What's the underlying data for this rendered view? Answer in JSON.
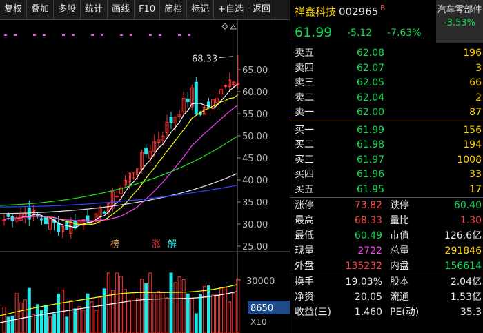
{
  "toolbar": [
    "复权",
    "叠加",
    "多股",
    "统计",
    "画线",
    "F10",
    "简档",
    "标记",
    "+自选",
    "返回"
  ],
  "stock": {
    "name": "祥鑫科技",
    "code": "002965",
    "badge": "R",
    "price": "61.99",
    "change": "-5.12",
    "change_pct": "-7.63%"
  },
  "sector": {
    "name": "汽车零部件",
    "change": "-3.53%"
  },
  "sells": [
    {
      "label": "卖五",
      "price": "62.08",
      "vol": "196"
    },
    {
      "label": "卖四",
      "price": "62.07",
      "vol": "3"
    },
    {
      "label": "卖三",
      "price": "62.05",
      "vol": "66"
    },
    {
      "label": "卖二",
      "price": "62.04",
      "vol": "2"
    },
    {
      "label": "卖一",
      "price": "62.00",
      "vol": "87"
    }
  ],
  "buys": [
    {
      "label": "买一",
      "price": "61.99",
      "vol": "156"
    },
    {
      "label": "买二",
      "price": "61.98",
      "vol": "194"
    },
    {
      "label": "买三",
      "price": "61.97",
      "vol": "1008"
    },
    {
      "label": "买四",
      "price": "61.96",
      "vol": "33"
    },
    {
      "label": "买五",
      "price": "61.95",
      "vol": "17"
    }
  ],
  "stats1": [
    {
      "k1": "涨停",
      "v1": "73.82",
      "c1": "red",
      "k2": "跌停",
      "v2": "60.40",
      "c2": "grn"
    },
    {
      "k1": "最高",
      "v1": "68.33",
      "c1": "red",
      "k2": "量比",
      "v2": "1.30",
      "c2": "red"
    },
    {
      "k1": "最低",
      "v1": "60.49",
      "c1": "grn",
      "k2": "市值",
      "v2": "126.6亿",
      "c2": "wht"
    },
    {
      "k1": "现量",
      "v1": "2722",
      "c1": "mag",
      "k2": "总量",
      "v2": "291846",
      "c2": "ylw"
    },
    {
      "k1": "外盘",
      "v1": "135232",
      "c1": "red",
      "k2": "内盘",
      "v2": "156614",
      "c2": "grn"
    }
  ],
  "stats2": [
    {
      "k1": "换手",
      "v1": "19.03%",
      "c1": "wht",
      "k2": "股本",
      "v2": "2.04亿",
      "c2": "wht"
    },
    {
      "k1": "净资",
      "v1": "20.05",
      "c1": "wht",
      "k2": "流通",
      "v2": "1.53亿",
      "c2": "wht"
    },
    {
      "k1": "收益(三)",
      "v1": "1.460",
      "c1": "wht",
      "k2": "PE(动)",
      "v2": "35.3",
      "c2": "wht"
    }
  ],
  "chart": {
    "price_ticks": [
      "65.00",
      "60.00",
      "55.00",
      "50.00",
      "45.00",
      "40.00",
      "35.00",
      "30.00",
      "25.00"
    ],
    "high_label": "68.33",
    "vol_tick": "30000",
    "vol_current": "8650",
    "vol_unit": "X10",
    "events": [
      "榜",
      "涨",
      "解"
    ],
    "colors": {
      "up": "#ff3030",
      "down": "#20e8e8",
      "ma5": "#ffffff",
      "ma10": "#ffff00",
      "ma20": "#ff40ff",
      "ma60": "#22dd22",
      "ma120": "#dddddd",
      "ma250": "#3344ff"
    }
  }
}
